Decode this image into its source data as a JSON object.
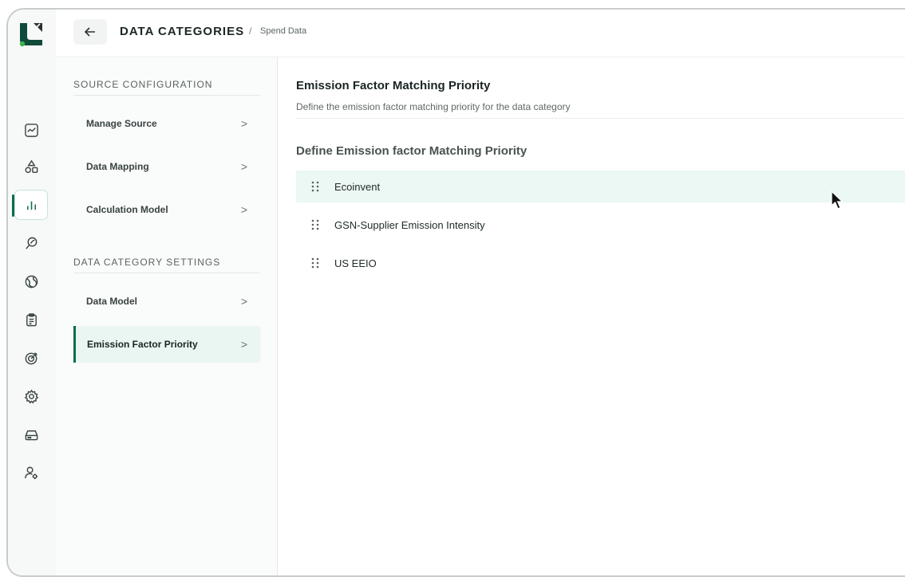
{
  "header": {
    "title": "DATA CATEGORIES",
    "separator": "/",
    "subtitle": "Spend Data",
    "back_icon": "arrow-left-icon"
  },
  "rail": {
    "logo": "brand-logo",
    "items": [
      {
        "icon": "trend-chart-icon",
        "active": false
      },
      {
        "icon": "shapes-icon",
        "active": false
      },
      {
        "icon": "bar-chart-icon",
        "active": true
      },
      {
        "icon": "leaf-search-icon",
        "active": false
      },
      {
        "icon": "globe-icon",
        "active": false
      },
      {
        "icon": "clipboard-icon",
        "active": false
      },
      {
        "icon": "target-icon",
        "active": false
      },
      {
        "icon": "gear-icon",
        "active": false
      },
      {
        "icon": "drive-icon",
        "active": false
      },
      {
        "icon": "user-settings-icon",
        "active": false
      }
    ]
  },
  "sidebar": {
    "source_section": "SOURCE CONFIGURATION",
    "source_items": [
      {
        "label": "Manage Source"
      },
      {
        "label": "Data Mapping"
      },
      {
        "label": "Calculation Model"
      }
    ],
    "settings_section": "DATA CATEGORY SETTINGS",
    "settings_items": [
      {
        "label": "Data Model",
        "active": false
      },
      {
        "label": "Emission Factor Priority",
        "active": true
      }
    ],
    "chevron": ">"
  },
  "main": {
    "title": "Emission Factor Matching Priority",
    "description": "Define the emission factor matching priority for the data category",
    "section_title": "Define Emission factor Matching Priority",
    "priorities": [
      {
        "label": "Ecoinvent"
      },
      {
        "label": "GSN-Supplier Emission Intensity"
      },
      {
        "label": "US EEIO"
      }
    ]
  },
  "colors": {
    "accent": "#0f6b4e",
    "active_bg": "#eaf6f1",
    "hover_row": "#ecf8f3"
  }
}
